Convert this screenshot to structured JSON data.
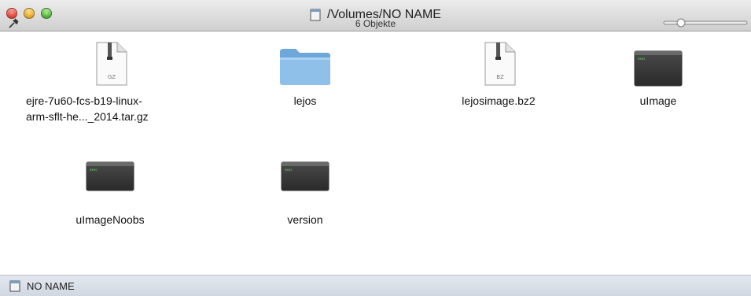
{
  "window": {
    "title": "/Volumes/NO NAME",
    "item_count": "6 Objekte"
  },
  "items": [
    {
      "name": "ejre-7u60-fcs-b19-linux-",
      "name2": "arm-sflt-he..._2014.tar.gz",
      "icon": "zip-archive-icon",
      "badge": "GZ"
    },
    {
      "name": "lejos",
      "icon": "folder-icon"
    },
    {
      "name": "lejosimage.bz2",
      "icon": "zip-archive-icon",
      "badge": "BZ"
    },
    {
      "name": "uImage",
      "icon": "executable-icon"
    },
    {
      "name": "uImageNoobs",
      "icon": "executable-icon"
    },
    {
      "name": "version",
      "icon": "executable-icon"
    }
  ],
  "statusbar": {
    "volume": "NO NAME"
  },
  "colors": {
    "folder": "#7fb2e0",
    "statusbar": "#d8dde6"
  }
}
